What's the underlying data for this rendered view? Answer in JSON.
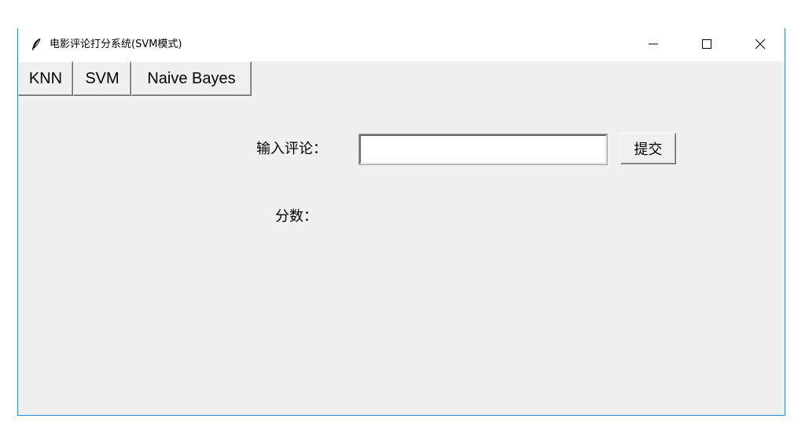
{
  "window": {
    "title": "电影评论打分系统(SVM模式)",
    "app_icon": "feather-icon",
    "controls": {
      "minimize_icon": "minimize-icon",
      "maximize_icon": "maximize-icon",
      "close_icon": "close-icon"
    },
    "border_color": "#2b8fd6"
  },
  "tabs": [
    {
      "label": "KNN"
    },
    {
      "label": "SVM"
    },
    {
      "label": "Naive Bayes"
    }
  ],
  "form": {
    "review_label": "输入评论：",
    "review_value": "",
    "submit_label": "提交",
    "score_label": "分数：",
    "score_value": ""
  }
}
